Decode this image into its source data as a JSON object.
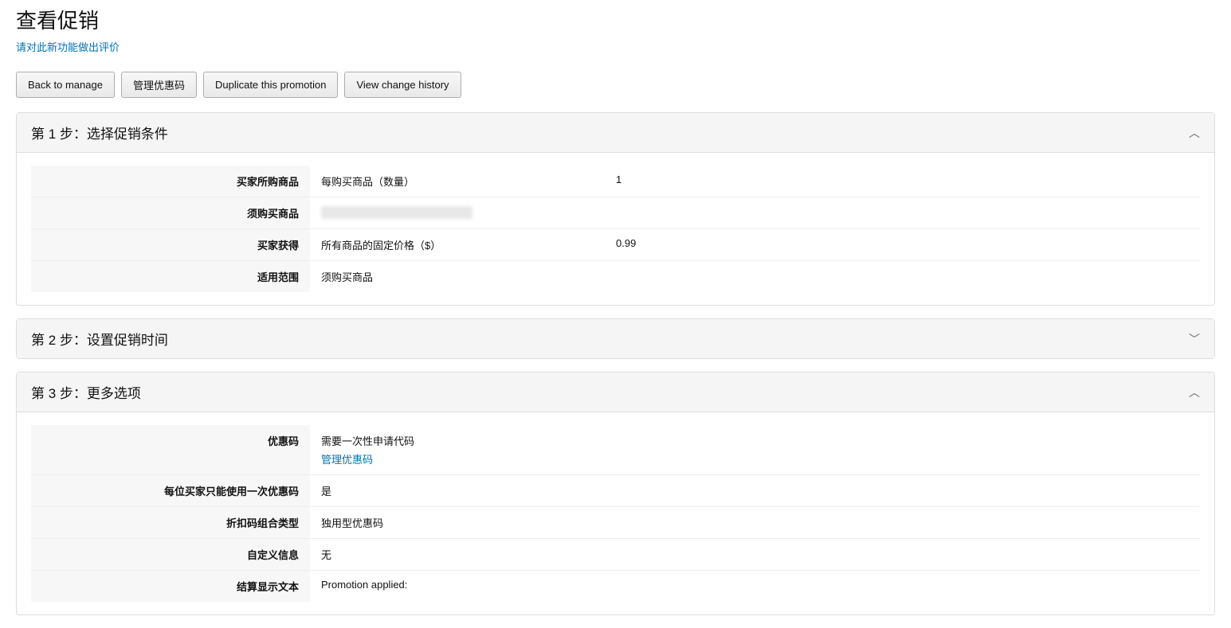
{
  "header": {
    "title": "查看促销",
    "rating_link": "请对此新功能做出评价"
  },
  "buttons": {
    "back": "Back to manage",
    "manage_codes": "管理优惠码",
    "duplicate": "Duplicate this promotion",
    "history": "View change history"
  },
  "step1": {
    "title": "第 1 步：选择促销条件",
    "rows": {
      "buyer_purchase_label": "买家所购商品",
      "buyer_purchase_desc": "每购买商品（数量）",
      "buyer_purchase_qty": "1",
      "must_purchase_label": "须购买商品",
      "buyer_gets_label": "买家获得",
      "buyer_gets_desc": "所有商品的固定价格（$）",
      "buyer_gets_value": "0.99",
      "applies_to_label": "适用范围",
      "applies_to_value": "须购买商品"
    }
  },
  "step2": {
    "title": "第 2 步：设置促销时间"
  },
  "step3": {
    "title": "第 3 步：更多选项",
    "rows": {
      "code_label": "优惠码",
      "code_value": "需要一次性申请代码",
      "code_link": "管理优惠码",
      "one_per_label": "每位买家只能使用一次优惠码",
      "one_per_value": "是",
      "combo_label": "折扣码组合类型",
      "combo_value": "独用型优惠码",
      "custom_label": "自定义信息",
      "custom_value": "无",
      "checkout_label": "结算显示文本",
      "checkout_value": "Promotion applied:"
    }
  }
}
